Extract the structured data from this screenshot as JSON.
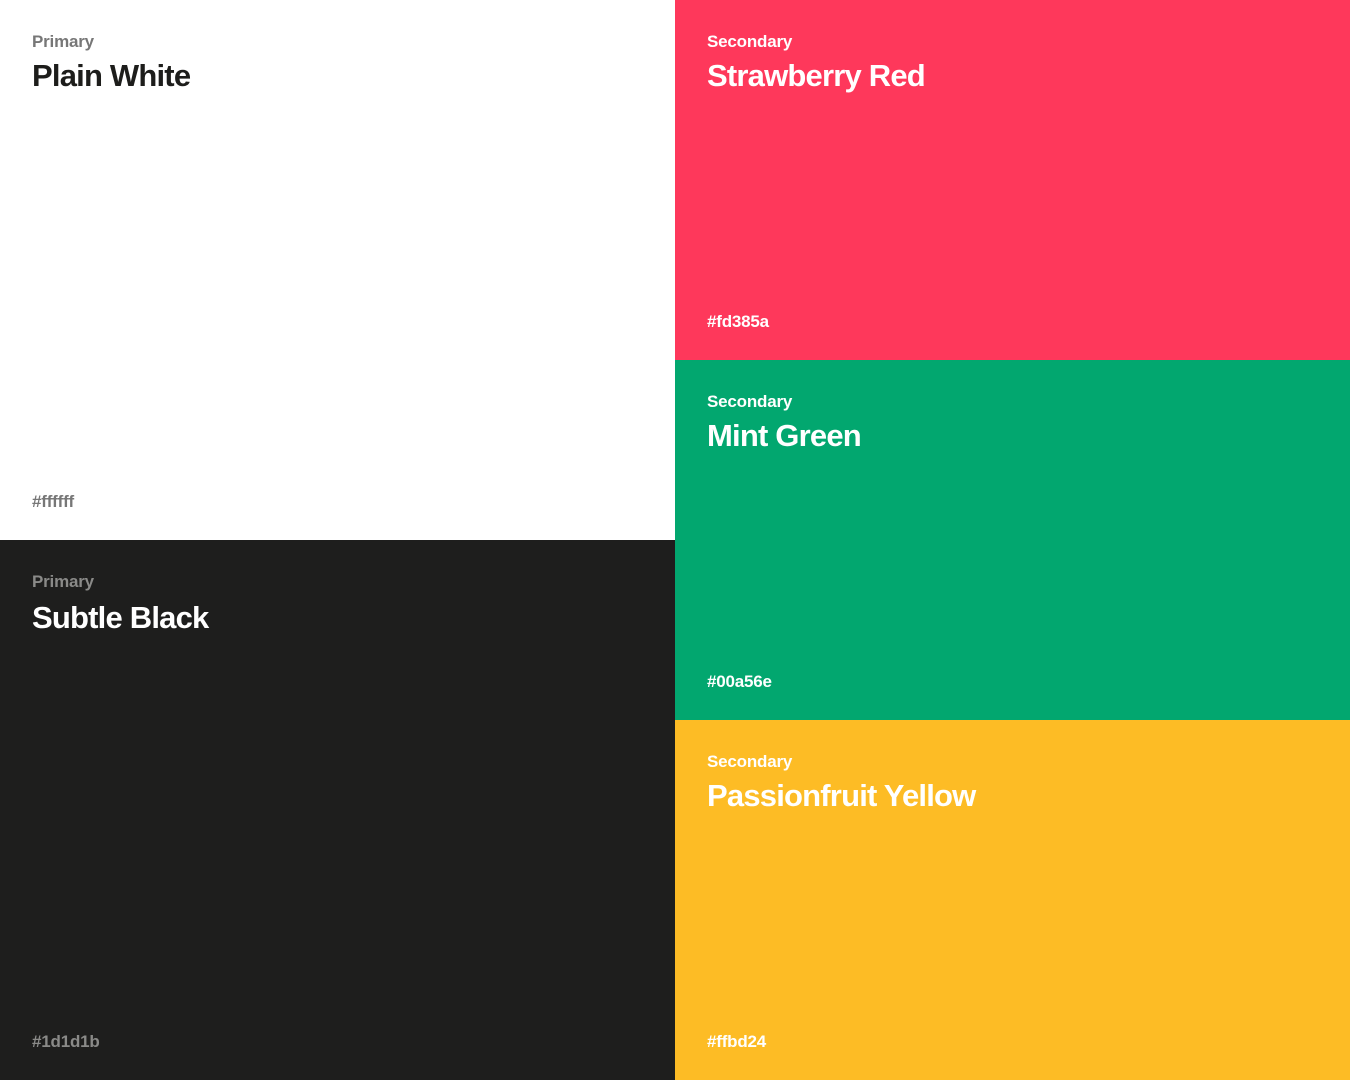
{
  "swatches": [
    {
      "id": "white",
      "tier": "Primary",
      "name": "Plain White",
      "hex": "#ffffff",
      "bg": "#ffffff",
      "fg": "#1d1d1b",
      "muted": "#777777"
    },
    {
      "id": "black",
      "tier": "Primary",
      "name": "Subtle Black",
      "hex": "#1d1d1b",
      "bg": "#1e1e1d",
      "fg": "#ffffff",
      "muted": "#8a8a88"
    },
    {
      "id": "red",
      "tier": "Secondary",
      "name": "Strawberry Red",
      "hex": "#fd385a",
      "bg": "#fe385b",
      "fg": "#ffffff",
      "muted": "#ffffff"
    },
    {
      "id": "green",
      "tier": "Secondary",
      "name": "Mint Green",
      "hex": "#00a56e",
      "bg": "#02a76f",
      "fg": "#ffffff",
      "muted": "#ffffff"
    },
    {
      "id": "yellow",
      "tier": "Secondary",
      "name": "Passionfruit Yellow",
      "hex": "#ffbd24",
      "bg": "#fdbc25",
      "fg": "#ffffff",
      "muted": "#ffffff"
    }
  ]
}
